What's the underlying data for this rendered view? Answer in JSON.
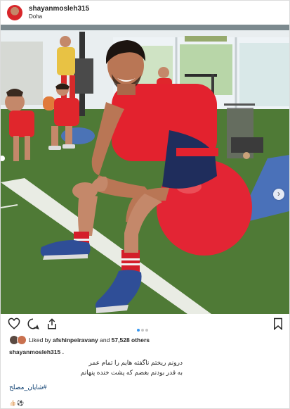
{
  "header": {
    "username": "shayanmosleh315",
    "location": "Doha"
  },
  "photo": {
    "subject": "player seated on red exercise ball"
  },
  "actions": {
    "icons": [
      "heart-icon",
      "comment-icon",
      "share-icon",
      "bookmark-icon"
    ],
    "carousel": {
      "count": 3,
      "active": 0
    }
  },
  "likes": {
    "prefix": "Liked by ",
    "user": "afshinpeiravany",
    "middle": " and ",
    "count": "57,528 others"
  },
  "caption": {
    "username": "shayanmosleh315 .",
    "line1": "درونم ریختم ناگفته هایم را تمام عمر",
    "line2": "به قدر بودنم بغضم که پشت خنده پنهانم",
    "hashtag": "#شایان_مصلح",
    "emoji": "👍🏻⚽"
  },
  "colors": {
    "accent_link": "#003569",
    "carousel_active": "#3897f0",
    "jersey_red": "#e3222e",
    "ball_red": "#e32534",
    "turf_green": "#4f7a36"
  }
}
